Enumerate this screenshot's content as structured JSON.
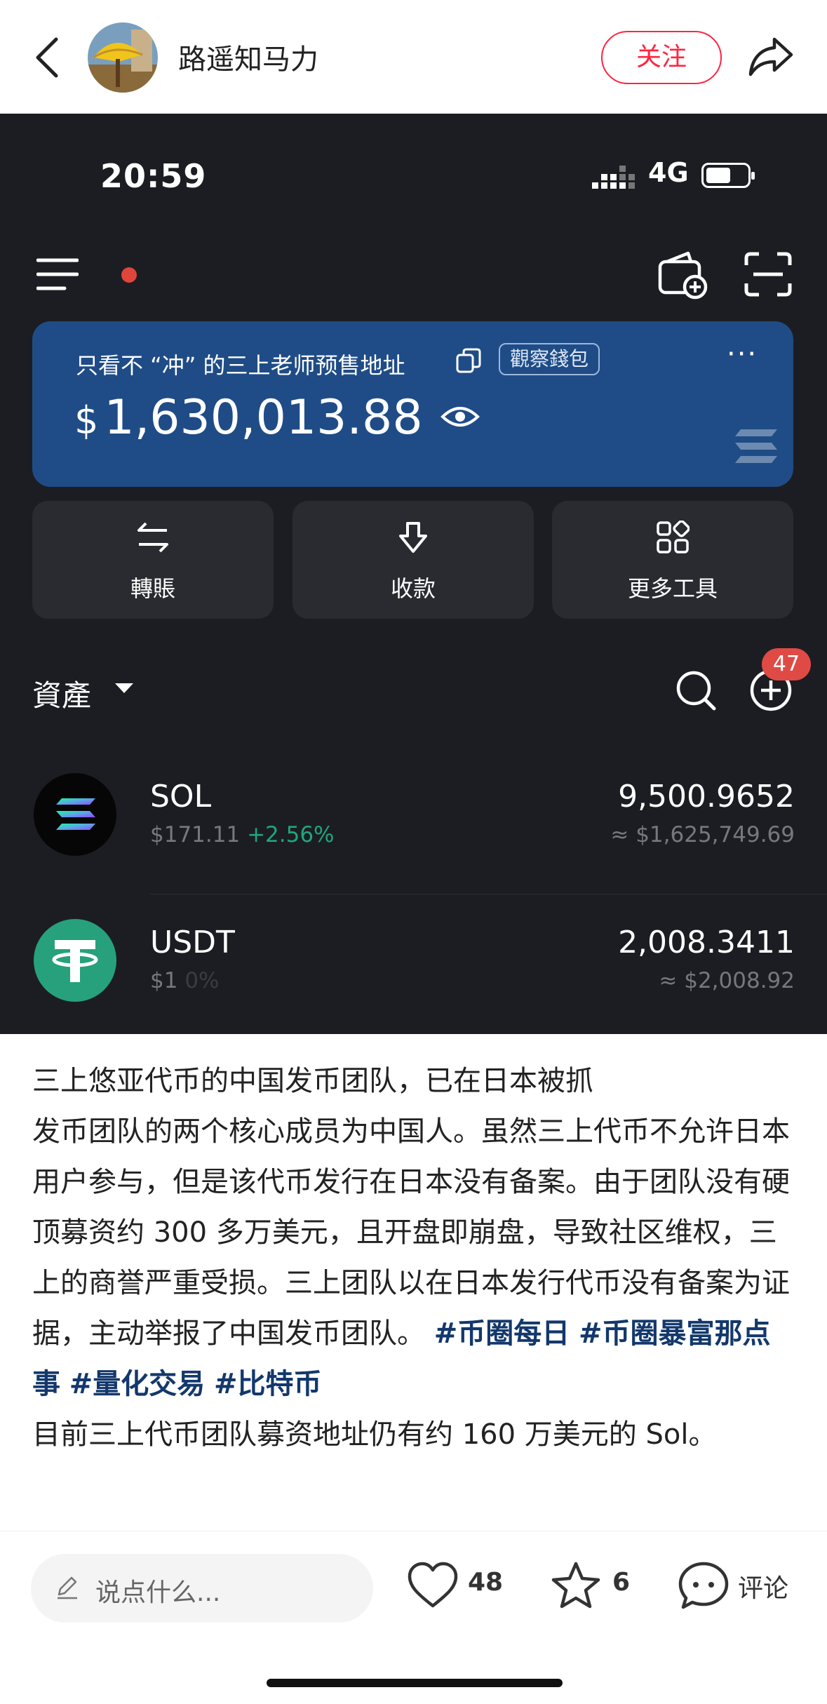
{
  "header": {
    "username": "路遥知马力",
    "follow_label": "关注"
  },
  "wallet_screen": {
    "status": {
      "time": "20:59",
      "network": "4G"
    },
    "card": {
      "wallet_name": "只看不 “冲” 的三上老师预售地址",
      "watch_label": "觀察錢包",
      "more_label": "···",
      "currency_symbol": "$",
      "balance": "1,630,013.88"
    },
    "actions": [
      {
        "label": "轉賬",
        "icon": "transfer-icon"
      },
      {
        "label": "收款",
        "icon": "receive-icon"
      },
      {
        "label": "更多工具",
        "icon": "more-tools-icon"
      }
    ],
    "assets": {
      "title": "資產",
      "badge": "47",
      "items": [
        {
          "symbol": "SOL",
          "price": "$171.11",
          "change": "+2.56%",
          "change_color": "#1fa67a",
          "amount": "9,500.9652",
          "value": "≈ $1,625,749.69"
        },
        {
          "symbol": "USDT",
          "price": "$1",
          "change": "0%",
          "change_color": "#3a3c42",
          "amount": "2,008.3411",
          "value": "≈ $2,008.92"
        }
      ]
    }
  },
  "post": {
    "lines": [
      "三上悠亚代币的中国发币团队，已在日本被抓",
      "发币团队的两个核心成员为中国人。虽然三上代币不允许日本用户参与，但是该代币发行在日本没有备案。由于团队没有硬顶募资约 300 多万美元，且开盘即崩盘，导致社区维权，三上的商誉严重受损。三上团队以在日本发行代币没有备案为证据，主动举报了中国发币团队。"
    ],
    "tags": [
      "#币圈每日",
      "#币圈暴富那点事",
      "#量化交易",
      "#比特币"
    ],
    "last_line": "目前三上代币团队募资地址仍有约 160 万美元的 Sol。"
  },
  "bottom_bar": {
    "comment_placeholder": "说点什么...",
    "likes": "48",
    "favorites": "6",
    "comment_label": "评论"
  }
}
